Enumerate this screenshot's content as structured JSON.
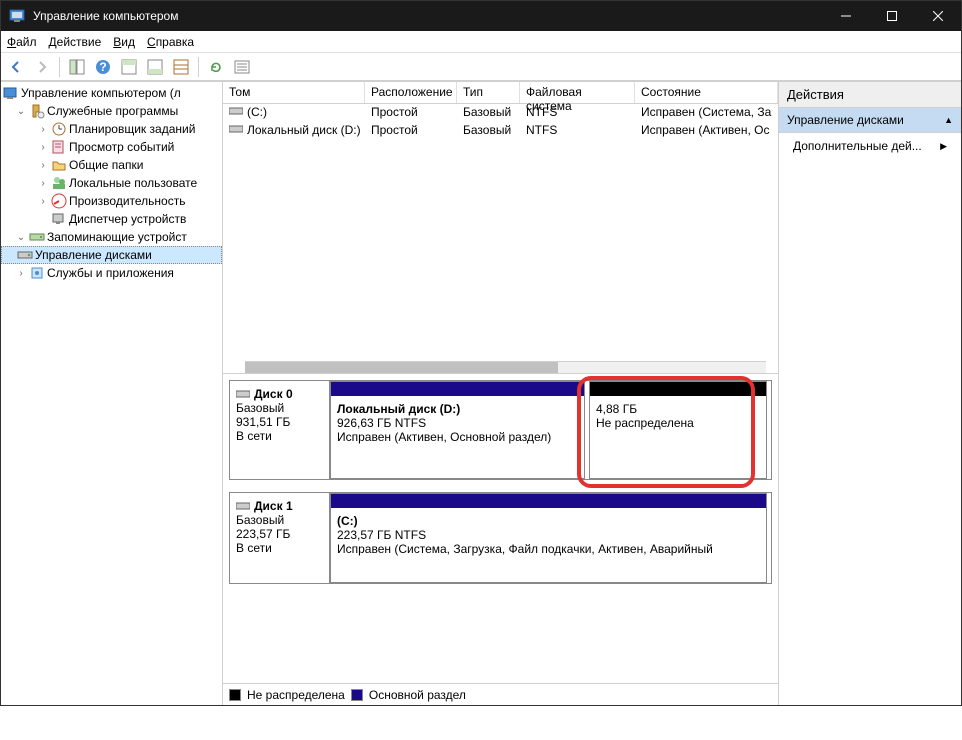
{
  "window": {
    "title": "Управление компьютером"
  },
  "menubar": [
    "Файл",
    "Действие",
    "Вид",
    "Справка"
  ],
  "tree": {
    "root": "Управление компьютером (л",
    "utilities": "Служебные программы",
    "scheduler": "Планировщик заданий",
    "events": "Просмотр событий",
    "shared": "Общие папки",
    "users": "Локальные пользовате",
    "perf": "Производительность",
    "devmgr": "Диспетчер устройств",
    "storage": "Запоминающие устройст",
    "diskmgmt": "Управление дисками",
    "services": "Службы и приложения"
  },
  "volumes": {
    "headers": {
      "vol": "Том",
      "layout": "Расположение",
      "type": "Тип",
      "fs": "Файловая система",
      "state": "Состояние"
    },
    "rows": [
      {
        "vol": "(C:)",
        "layout": "Простой",
        "type": "Базовый",
        "fs": "NTFS",
        "state": "Исправен (Система, За"
      },
      {
        "vol": "Локальный диск (D:)",
        "layout": "Простой",
        "type": "Базовый",
        "fs": "NTFS",
        "state": "Исправен (Активен, Ос"
      }
    ]
  },
  "disks": {
    "d0": {
      "name": "Диск 0",
      "type": "Базовый",
      "size": "931,51 ГБ",
      "status": "В сети"
    },
    "d0p1": {
      "title": "Локальный диск  (D:)",
      "line1": "926,63 ГБ NTFS",
      "line2": "Исправен (Активен, Основной раздел)"
    },
    "d0p2": {
      "line1": "4,88 ГБ",
      "line2": "Не распределена"
    },
    "d1": {
      "name": "Диск 1",
      "type": "Базовый",
      "size": "223,57 ГБ",
      "status": "В сети"
    },
    "d1p1": {
      "title": "(C:)",
      "line1": "223,57 ГБ NTFS",
      "line2": "Исправен (Система, Загрузка, Файл подкачки, Активен, Аварийный"
    }
  },
  "legend": {
    "unalloc": "Не распределена",
    "primary": "Основной раздел"
  },
  "actions": {
    "title": "Действия",
    "selected": "Управление дисками",
    "more": "Дополнительные дей..."
  }
}
